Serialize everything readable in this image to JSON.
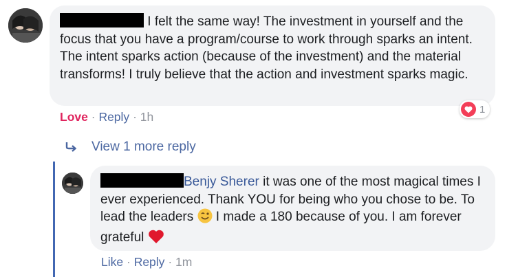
{
  "comment1": {
    "text": "I felt the same way! The investment in yourself and the focus that you have a program/course to work through sparks an intent. The intent sparks action (because of the investment) and the material transforms! I truly believe that the action and investment sparks magic.",
    "reaction_label": "Love",
    "reply_label": "Reply",
    "sep": "·",
    "time": "1h",
    "reaction_count": "1"
  },
  "view_more": {
    "label": "View 1 more reply"
  },
  "reply1": {
    "mention": "Benjy Sherer",
    "text_part1": " it was one of the most magical times I ever experienced. Thank YOU for being who you chose to be. To lead the leaders ",
    "text_part2": " I made a 180 because of you. I am forever grateful ",
    "like_label": "Like",
    "reply_label": "Reply",
    "sep": "·",
    "time": "1m"
  },
  "colors": {
    "accent_link": "#4b67a1",
    "love_red": "#e0245e",
    "bubble_bg": "#f2f3f5",
    "thread_line": "#4267b2"
  },
  "icons": [
    "avatar-1",
    "avatar-2",
    "reply-arrow-icon",
    "heart-reaction-icon",
    "wink-emoji-icon",
    "red-heart-emoji-icon"
  ]
}
